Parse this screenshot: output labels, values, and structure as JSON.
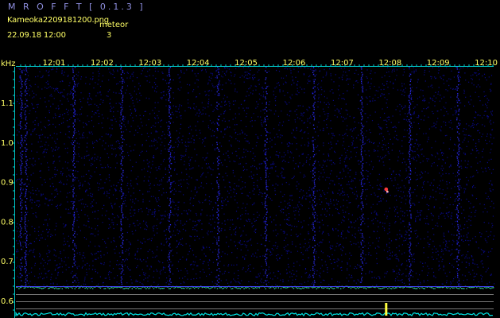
{
  "header": {
    "app_title": "M R O F F T  [ 0.1.3 ]",
    "file_name": "Kameoka2209181200.png",
    "meteor_label": "meteor",
    "datetime": "22.09.18 12:00",
    "meteor_count": "3"
  },
  "colors": {
    "background": "#000000",
    "label": "#ffff66",
    "title": "#8f8fe0",
    "tick": "#00cccc",
    "noise": "#0a0a9a",
    "baseline": "#00e5e5",
    "detection": "#ff3b3b"
  },
  "plot": {
    "unit_label": "kHz",
    "time_labels": [
      "12:01",
      "12:02",
      "12:03",
      "12:04",
      "12:05",
      "12:06",
      "12:07",
      "12:08",
      "12:09",
      "12:10"
    ],
    "freq_labels": [
      "1.1",
      "1.0",
      "0.9",
      "0.8",
      "0.7",
      "0.6"
    ],
    "meteor_detections": [
      {
        "time": "12:08",
        "freq_khz": 0.87
      }
    ]
  }
}
